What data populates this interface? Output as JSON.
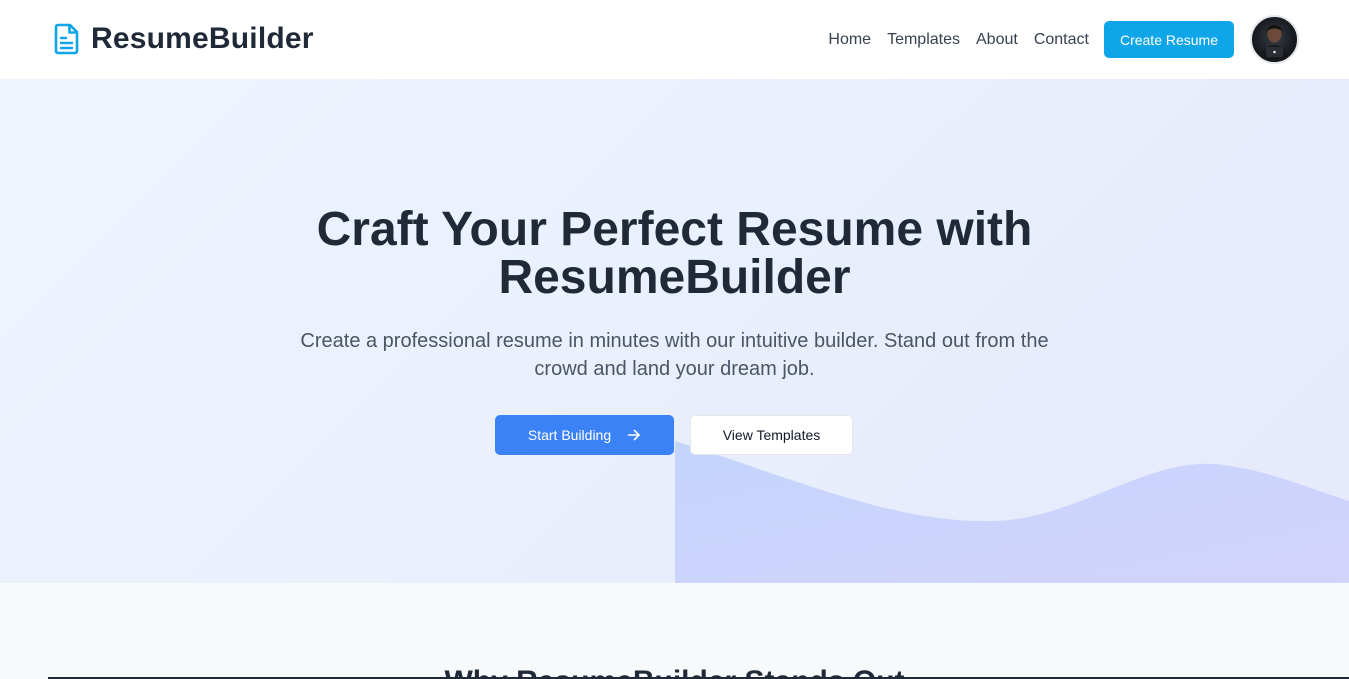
{
  "brand": {
    "name": "ResumeBuilder",
    "icon": "document-icon",
    "color": "#0ea5e9"
  },
  "nav": {
    "links": [
      "Home",
      "Templates",
      "About",
      "Contact"
    ],
    "cta_label": "Create Resume",
    "avatar": "user-avatar"
  },
  "hero": {
    "title": "Craft Your Perfect Resume with ResumeBuilder",
    "subtitle": "Create a professional resume in minutes with our intuitive builder. Stand out from the crowd and land your dream job.",
    "primary_label": "Start Building",
    "primary_icon": "arrow-right-icon",
    "secondary_label": "View Templates"
  },
  "features": {
    "title": "Why ResumeBuilder Stands Out"
  },
  "colors": {
    "accent": "#0ea5e9",
    "primary": "#3b82f6",
    "hero_bg": "#eef3fd",
    "wave": "#c7d6fb",
    "text_dark": "#1f2937"
  }
}
